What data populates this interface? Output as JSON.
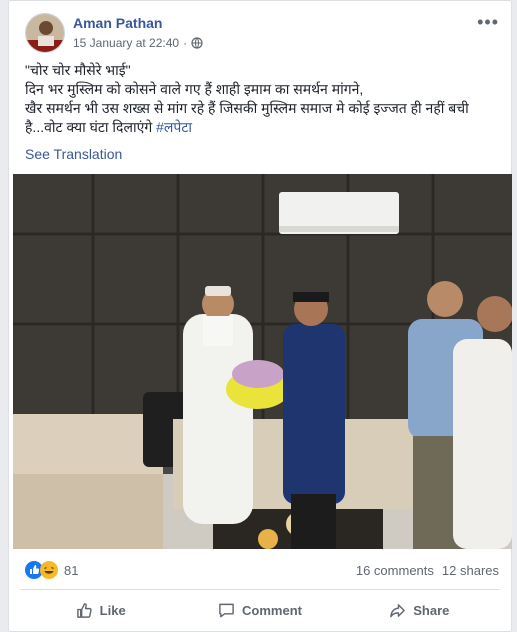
{
  "post": {
    "author": "Aman Pathan",
    "timestamp": "15 January at 22:40",
    "privacy_icon": "globe-icon",
    "more_label": "•••",
    "text_lines": [
      "\"चोर चोर मौसेरे भाई\"",
      "दिन भर मुस्लिम को कोसने वाले गए हैं शाही इमाम का समर्थन मांगने,",
      "खैर समर्थन भी उस शख्स से मांग रहे हैं जिसकी मुस्लिम समाज मे कोई इज्जत ही नहीं बची"
    ],
    "last_line_text": "है...वोट क्या घंटा दिलाएंगे ",
    "hashtag": "#लपेटा",
    "see_translation": "See Translation"
  },
  "stats": {
    "reaction_icons": [
      "like-reaction-icon",
      "haha-reaction-icon"
    ],
    "reaction_count": "81",
    "comments": "16 comments",
    "shares": "12 shares"
  },
  "actions": {
    "like": "Like",
    "comment": "Comment",
    "share": "Share"
  },
  "colors": {
    "link": "#385898",
    "muted": "#606770",
    "like_blue": "#1877f2",
    "haha_yellow": "#f7b928"
  }
}
